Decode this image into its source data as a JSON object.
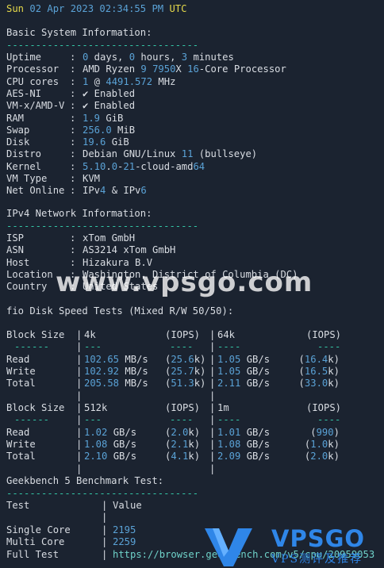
{
  "header": {
    "date_parts": [
      "Sun ",
      "02 Apr 2023 02:34:55 PM",
      " UTC"
    ]
  },
  "sections": {
    "basic_title": "Basic System Information:",
    "ipv4_title": "IPv4 Network Information:",
    "fio_title": "fio Disk Speed Tests (Mixed R/W 50/50):",
    "geek_title": "Geekbench 5 Benchmark Test:",
    "divider": "---------------------------------"
  },
  "basic": [
    {
      "label": "Uptime",
      "value": "0 days, 0 hours, 3 minutes"
    },
    {
      "label": "Processor",
      "value": "AMD Ryzen 9 7950X 16-Core Processor"
    },
    {
      "label": "CPU cores",
      "value": "1 @ 4491.572 MHz"
    },
    {
      "label": "AES-NI",
      "value": "✔ Enabled"
    },
    {
      "label": "VM-x/AMD-V",
      "value": "✔ Enabled"
    },
    {
      "label": "RAM",
      "value": "1.9 GiB"
    },
    {
      "label": "Swap",
      "value": "256.0 MiB"
    },
    {
      "label": "Disk",
      "value": "19.6 GiB"
    },
    {
      "label": "Distro",
      "value": "Debian GNU/Linux 11 (bullseye)"
    },
    {
      "label": "Kernel",
      "value": "5.10.0-21-cloud-amd64"
    },
    {
      "label": "VM Type",
      "value": "KVM"
    },
    {
      "label": "Net Online",
      "value": "IPv4 & IPv6"
    }
  ],
  "ipv4": [
    {
      "label": "ISP",
      "value": "xTom GmbH"
    },
    {
      "label": "ASN",
      "value": "AS3214 xTom GmbH"
    },
    {
      "label": "Host",
      "value": "Hizakura B.V"
    },
    {
      "label": "Location",
      "value": "Washington, District of Columbia (DC)"
    },
    {
      "label": "Country",
      "value": "United States"
    }
  ],
  "fio": {
    "block_label": "Block Size",
    "iops_label": "(IOPS)",
    "dashes": "------",
    "blocks": [
      {
        "left": "4k",
        "right": "64k",
        "rows": [
          {
            "op": "Read",
            "lv": "102.65 MB/s",
            "li": "(25.6k)",
            "rv": "1.05 GB/s",
            "ri": "(16.4k)"
          },
          {
            "op": "Write",
            "lv": "102.92 MB/s",
            "li": "(25.7k)",
            "rv": "1.05 GB/s",
            "ri": "(16.5k)"
          },
          {
            "op": "Total",
            "lv": "205.58 MB/s",
            "li": "(51.3k)",
            "rv": "2.11 GB/s",
            "ri": "(33.0k)"
          }
        ]
      },
      {
        "left": "512k",
        "right": "1m",
        "rows": [
          {
            "op": "Read",
            "lv": "1.02 GB/s",
            "li": "(2.0k)",
            "rv": "1.01 GB/s",
            "ri": "(990)"
          },
          {
            "op": "Write",
            "lv": "1.08 GB/s",
            "li": "(2.1k)",
            "rv": "1.08 GB/s",
            "ri": "(1.0k)"
          },
          {
            "op": "Total",
            "lv": "2.10 GB/s",
            "li": "(4.1k)",
            "rv": "2.09 GB/s",
            "ri": "(2.0k)"
          }
        ]
      }
    ]
  },
  "geekbench": {
    "head_test": "Test",
    "head_value": "Value",
    "rows": [
      {
        "label": "Single Core",
        "value": "2195"
      },
      {
        "label": "Multi Core",
        "value": "2259"
      },
      {
        "label": "Full Test",
        "value": "https://browser.geekbench.com/v5/cpu/20959053"
      }
    ]
  },
  "watermark": {
    "text": "www.vpsgo.com",
    "logo_text": "VPSGO",
    "logo_sub": "VPS测评及推荐"
  },
  "colors": {
    "background": "#1b2330",
    "text": "#d9dde3",
    "number": "#5aa2d6",
    "title": "#e4d84a",
    "divider": "#34c6a6",
    "link": "#6fd2c9"
  }
}
